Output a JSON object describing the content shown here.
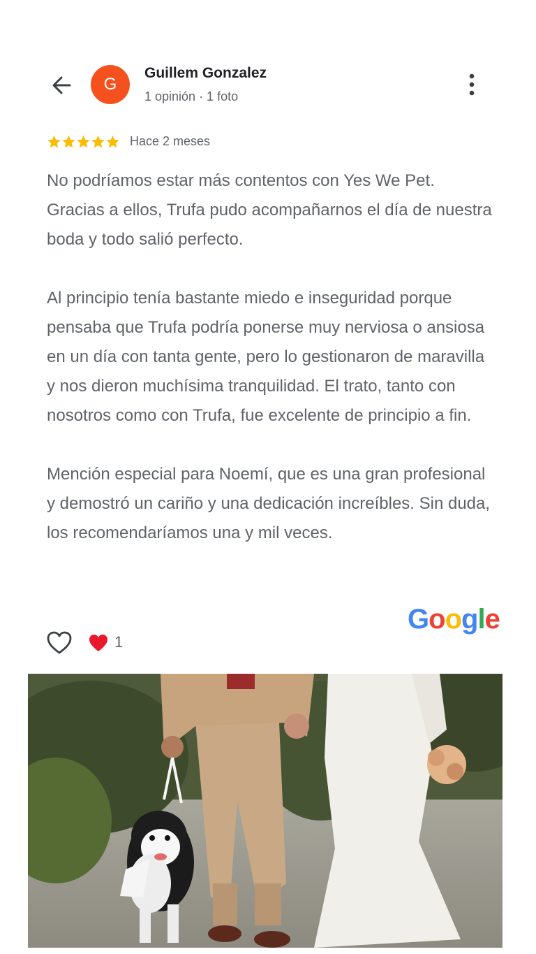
{
  "review": {
    "author": "Guillem Gonzalez",
    "avatar_letter": "G",
    "author_meta": "1 opinión · 1 foto",
    "rating": 5,
    "time": "Hace 2 meses",
    "paragraphs": [
      "No podríamos estar más contentos con Yes We Pet. Gracias a ellos, Trufa pudo acompañarnos el día de nuestra boda y todo salió perfecto.",
      "Al principio tenía bastante miedo e inseguridad porque pensaba que Trufa podría ponerse muy nerviosa o ansiosa en un día con tanta gente, pero lo gestionaron de maravilla y nos dieron muchísima tranquilidad. El trato, tanto con nosotros como con Trufa, fue excelente de principio a fin.",
      "Mención especial para Noemí, que es una gran profesional y demostró un cariño y una dedicación increíbles. Sin duda, los recomendaríamos una y mil veces."
    ],
    "reaction_count": "1",
    "brand": "Google"
  },
  "colors": {
    "avatar": "#f4511e",
    "star": "#fbbc04",
    "heart": "#e8192c",
    "google_blue": "#4285f4",
    "google_red": "#ea4335",
    "google_yellow": "#fbbc05",
    "google_green": "#34a853"
  },
  "icons": {
    "back": "arrow-left-icon",
    "more": "more-vertical-icon",
    "like": "heart-outline-icon",
    "reaction": "red-heart-icon"
  }
}
